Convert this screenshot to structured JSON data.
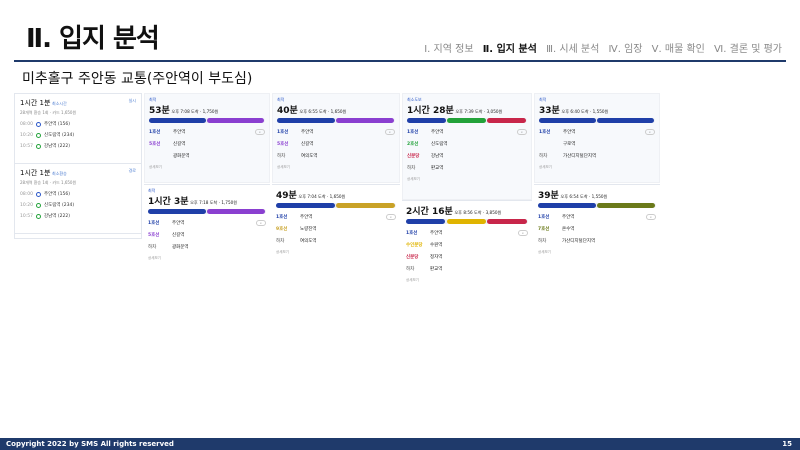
{
  "header": {
    "title": "Ⅱ. 입지 분석",
    "nav": [
      "Ⅰ. 지역 정보",
      "Ⅱ. 입지 분석",
      "Ⅲ. 시세 분석",
      "Ⅳ. 임장",
      "Ⅴ. 매물 확인",
      "Ⅵ. 결론 및 평가"
    ],
    "active_nav_index": 1
  },
  "subtitle": "미추홀구 주안동 교통(주안역이 부도심)",
  "left_panel": {
    "tab_labels": [
      "실시",
      "경로"
    ],
    "routes": [
      {
        "duration": "1시간 1분",
        "note": "최소시간",
        "meta": "28개역 환승 1회 · 카드 1,650원",
        "stops": [
          {
            "time": "08:00",
            "name": "주안역 (156)"
          },
          {
            "time": "10:20",
            "name": "신도림역 (234)"
          },
          {
            "time": "10:57",
            "name": "강남역 (222)"
          }
        ]
      },
      {
        "duration": "1시간 1분",
        "note": "최소환승",
        "meta": "28개역 환승 1회 · 카드 1,650원",
        "stops": [
          {
            "time": "08:00",
            "name": "주안역 (156)"
          },
          {
            "time": "10:20",
            "name": "신도림역 (234)"
          },
          {
            "time": "10:57",
            "name": "강남역 (222)"
          }
        ]
      }
    ]
  },
  "cards": [
    {
      "label": "최적",
      "duration": "53분",
      "meta": "오후 7:08 도착 · 1,750원",
      "lines": [
        {
          "name": "1호선",
          "stop": "주안역",
          "color": "#1f3fa8"
        },
        {
          "name": "5호선",
          "stop": "신길역",
          "color": "#8a3fd0"
        },
        {
          "name": "",
          "stop": "광화문역",
          "color": "#888"
        }
      ],
      "more": "상세보기"
    },
    {
      "label": "최적",
      "duration": "1시간 3분",
      "meta": "오후 7:18 도착 · 1,750원",
      "lines": [
        {
          "name": "1호선",
          "stop": "주안역",
          "color": "#1f3fa8"
        },
        {
          "name": "5호선",
          "stop": "신길역",
          "color": "#8a3fd0"
        },
        {
          "name": "하차",
          "stop": "광화문역",
          "color": "#888"
        }
      ],
      "more": "상세보기"
    },
    {
      "label": "최적",
      "duration": "40분",
      "meta": "오후 6:55 도착 · 1,650원",
      "lines": [
        {
          "name": "1호선",
          "stop": "주안역",
          "color": "#1f3fa8"
        },
        {
          "name": "5호선",
          "stop": "신길역",
          "color": "#8a3fd0"
        },
        {
          "name": "하차",
          "stop": "여의도역",
          "color": "#888"
        }
      ],
      "more": "상세보기"
    },
    {
      "label": "",
      "duration": "49분",
      "meta": "오후 7:04 도착 · 1,650원",
      "lines": [
        {
          "name": "1호선",
          "stop": "주안역",
          "color": "#1f3fa8"
        },
        {
          "name": "9호선",
          "stop": "노량진역",
          "color": "#c9a227"
        },
        {
          "name": "하차",
          "stop": "여의도역",
          "color": "#888"
        }
      ],
      "more": "상세보기"
    },
    {
      "label": "최소도보",
      "duration": "1시간 28분",
      "meta": "오후 7:39 도착 · 3,050원",
      "lines": [
        {
          "name": "1호선",
          "stop": "주안역",
          "color": "#1f3fa8"
        },
        {
          "name": "2호선",
          "stop": "신도림역",
          "color": "#23a23a"
        },
        {
          "name": "신분당",
          "stop": "강남역",
          "color": "#c8264a"
        },
        {
          "name": "하차",
          "stop": "판교역",
          "color": "#888"
        }
      ],
      "more": "상세보기"
    },
    {
      "label": "",
      "duration": "2시간 16분",
      "meta": "오후 8:56 도착 · 3,850원",
      "lines": [
        {
          "name": "1호선",
          "stop": "주안역",
          "color": "#1f3fa8"
        },
        {
          "name": "수인분당",
          "stop": "수원역",
          "color": "#e0b400"
        },
        {
          "name": "신분당",
          "stop": "정자역",
          "color": "#c8264a"
        },
        {
          "name": "하차",
          "stop": "판교역",
          "color": "#888"
        }
      ],
      "more": "상세보기"
    },
    {
      "label": "최적",
      "duration": "33분",
      "meta": "오후 6:40 도착 · 1,550원",
      "lines": [
        {
          "name": "1호선",
          "stop": "주안역",
          "color": "#1f3fa8"
        },
        {
          "name": "",
          "stop": "구로역",
          "color": "#1f3fa8"
        },
        {
          "name": "하차",
          "stop": "가산디지털단지역",
          "color": "#888"
        }
      ],
      "more": "상세보기"
    },
    {
      "label": "",
      "duration": "39분",
      "meta": "오후 6:54 도착 · 1,550원",
      "lines": [
        {
          "name": "1호선",
          "stop": "주안역",
          "color": "#1f3fa8"
        },
        {
          "name": "7호선",
          "stop": "온수역",
          "color": "#6b7a1a"
        },
        {
          "name": "하차",
          "stop": "가산디지털단지역",
          "color": "#888"
        }
      ],
      "more": "상세보기"
    }
  ],
  "footer": {
    "copyright": "Copyright 2022 by SMS All rights reserved",
    "page": "15"
  }
}
